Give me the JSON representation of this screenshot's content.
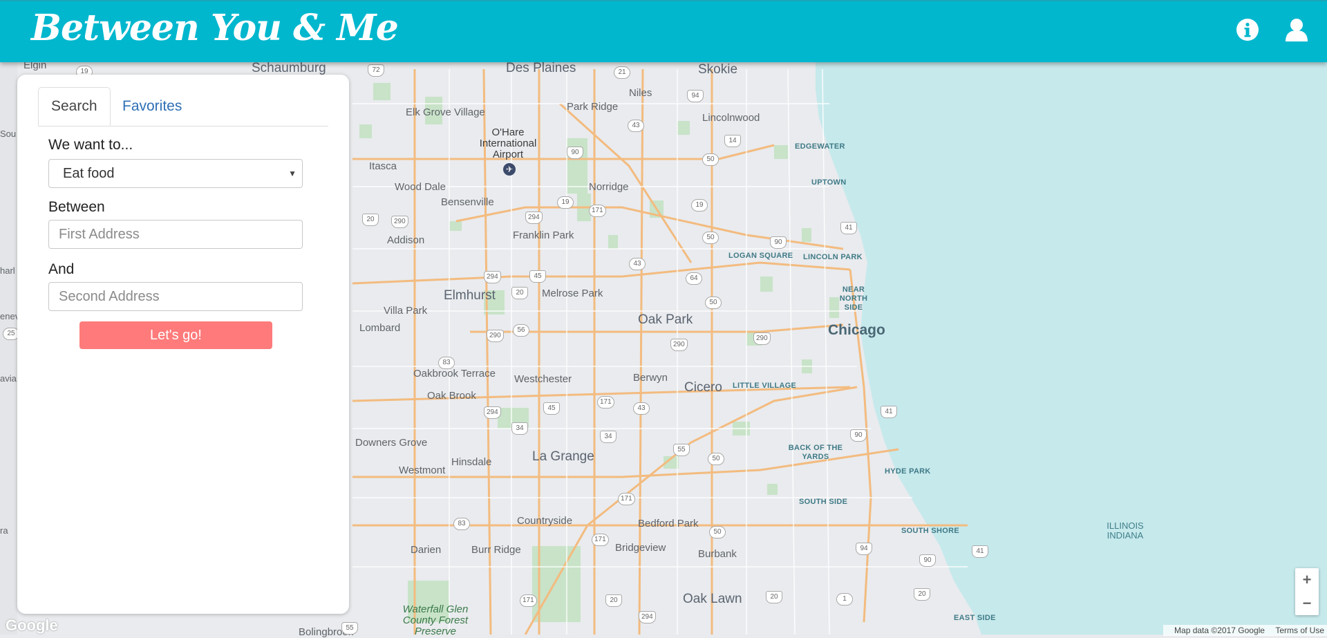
{
  "header": {
    "brand": "Between You & Me",
    "info_icon": "info-circle-icon",
    "user_icon": "user-icon",
    "color": "#00b7ce"
  },
  "panel": {
    "tabs": [
      {
        "label": "Search",
        "active": true
      },
      {
        "label": "Favorites",
        "active": false
      }
    ],
    "activity_label": "We want to...",
    "activity_value": "Eat food",
    "between_label": "Between",
    "first_placeholder": "First Address",
    "and_label": "And",
    "second_placeholder": "Second Address",
    "go_label": "Let's go!",
    "go_color": "#ff7a7a"
  },
  "map": {
    "places": [
      "Elgin",
      "Schaumburg",
      "Des Plaines",
      "Skokie",
      "Niles",
      "Park Ridge",
      "Lincolnwood",
      "Elk Grove Village",
      "Itasca",
      "Wood Dale",
      "Bensenville",
      "Norridge",
      "Addison",
      "Franklin Park",
      "Elmhurst",
      "Melrose Park",
      "Villa Park",
      "Lombard",
      "Oak Park",
      "Chicago",
      "Oakbrook Terrace",
      "Oak Brook",
      "Westchester",
      "Berwyn",
      "Cicero",
      "Downers Grove",
      "Westmont",
      "Hinsdale",
      "La Grange",
      "Countryside",
      "Darien",
      "Burr Ridge",
      "Bridgeview",
      "Bedford Park",
      "Burbank",
      "Oak Lawn",
      "Bolingbrook"
    ],
    "airport": "O'Hare International Airport",
    "districts": [
      "EDGEWATER",
      "UPTOWN",
      "LINCOLN PARK",
      "LOGAN SQUARE",
      "NEAR NORTH SIDE",
      "LITTLE VILLAGE",
      "BACK OF THE YARDS",
      "SOUTH SIDE",
      "HYDE PARK",
      "SOUTH SHORE",
      "EAST SIDE"
    ],
    "water_label": "ILLINOIS INDIANA",
    "park_label": "Waterfall Glen County Forest Preserve",
    "edge_labels": [
      "Sou",
      "harl",
      "enev",
      "avia",
      "ra"
    ],
    "zoom_in": "+",
    "zoom_out": "−",
    "google": "Google",
    "attribution": "Map data ©2017 Google",
    "terms": "Terms of Use"
  }
}
